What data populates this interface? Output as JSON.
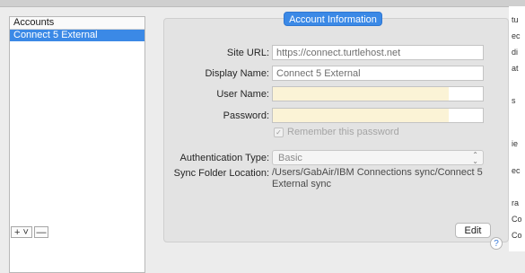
{
  "accounts": {
    "header": "Accounts",
    "items": [
      {
        "label": "Connect 5 External",
        "selected": true
      }
    ],
    "add_label": "+ ˅",
    "remove_label": "—"
  },
  "panel": {
    "tab_title": "Account Information",
    "site_url": {
      "label": "Site URL:",
      "value": "https://connect.turtlehost.net"
    },
    "display_name": {
      "label": "Display Name:",
      "value": "Connect 5 External"
    },
    "user_name": {
      "label": "User Name:",
      "value": ""
    },
    "password": {
      "label": "Password:",
      "value": ""
    },
    "remember": {
      "label": "Remember this password",
      "checked": true
    },
    "auth_type": {
      "label": "Authentication Type:",
      "value": "Basic"
    },
    "sync_folder": {
      "label": "Sync Folder Location:",
      "value": "/Users/GabAir/IBM Connections sync/Connect 5 External sync"
    },
    "edit_label": "Edit"
  },
  "help_label": "?",
  "right_fragment": [
    "tu",
    "ec",
    "di",
    "at",
    "s",
    "ie",
    "ec",
    "ra",
    "Co",
    "Co"
  ]
}
